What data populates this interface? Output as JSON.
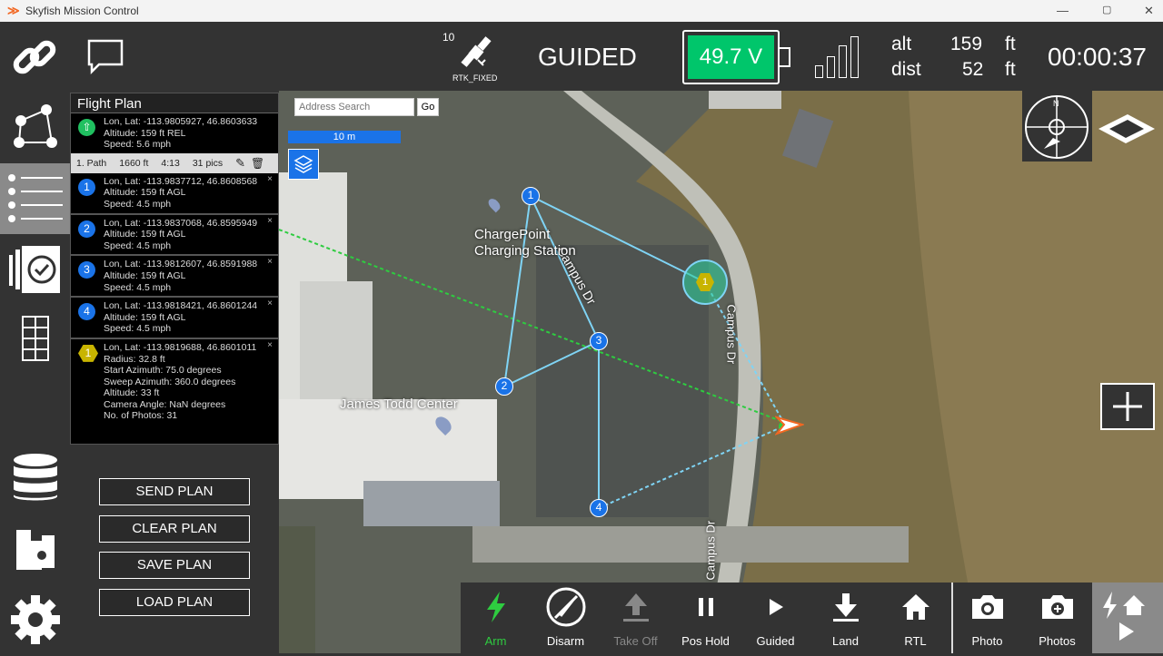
{
  "window": {
    "title": "Skyfish Mission Control",
    "controls": [
      "—",
      "▢",
      "✕"
    ]
  },
  "status": {
    "satellites": "10",
    "gps_fix": "RTK_FIXED",
    "mode": "GUIDED",
    "battery": "49.7 V",
    "battery_color": "#00c66b",
    "signal_bars": 4,
    "alt_label": "alt",
    "alt_value": "159",
    "alt_unit": "ft",
    "dist_label": "dist",
    "dist_value": "52",
    "dist_unit": "ft",
    "timer": "00:00:37"
  },
  "flight_plan": {
    "title": "Flight Plan",
    "takeoff": {
      "coords": "Lon, Lat: -113.9805927, 46.8603633",
      "altitude": "Altitude: 159 ft REL",
      "speed": "Speed: 5.6 mph"
    },
    "path": {
      "name": "1. Path",
      "length": "1660 ft",
      "time": "4:13",
      "pics": "31 pics"
    },
    "waypoints": [
      {
        "num": "1",
        "coords": "Lon, Lat: -113.9837712, 46.8608568",
        "altitude": "Altitude: 159 ft AGL",
        "speed": "Speed: 4.5 mph"
      },
      {
        "num": "2",
        "coords": "Lon, Lat: -113.9837068, 46.8595949",
        "altitude": "Altitude: 159 ft AGL",
        "speed": "Speed: 4.5 mph"
      },
      {
        "num": "3",
        "coords": "Lon, Lat: -113.9812607, 46.8591988",
        "altitude": "Altitude: 159 ft AGL",
        "speed": "Speed: 4.5 mph"
      },
      {
        "num": "4",
        "coords": "Lon, Lat: -113.9818421, 46.8601244",
        "altitude": "Altitude: 159 ft AGL",
        "speed": "Speed: 4.5 mph"
      }
    ],
    "orbit": {
      "num": "1",
      "coords": "Lon, Lat: -113.9819688, 46.8601011",
      "radius": "Radius: 32.8 ft",
      "start": "Start Azimuth: 75.0 degrees",
      "sweep": "Sweep Azimuth: 360.0 degrees",
      "altitude": "Altitude: 33 ft",
      "camera": "Camera Angle: NaN degrees",
      "photos": "No. of Photos: 31"
    },
    "close": "×"
  },
  "plan_buttons": {
    "send": "SEND PLAN",
    "clear": "CLEAR PLAN",
    "save": "SAVE PLAN",
    "load": "LOAD PLAN"
  },
  "map": {
    "search_placeholder": "Address Search",
    "go": "Go",
    "scale": "10 m",
    "labels": {
      "street1": "Campus Dr",
      "street2": "Campus Dr",
      "street3": "Campus Dr",
      "poi1": "ChargePoint\nCharging Station",
      "poi2": "James Todd Center"
    },
    "compass_n": "N"
  },
  "toolbar": {
    "arm": "Arm",
    "disarm": "Disarm",
    "takeoff": "Take Off",
    "poshold": "Pos Hold",
    "guided": "Guided",
    "land": "Land",
    "rtl": "RTL",
    "photo": "Photo",
    "photos": "Photos",
    "arm_color": "#2ecc40"
  }
}
